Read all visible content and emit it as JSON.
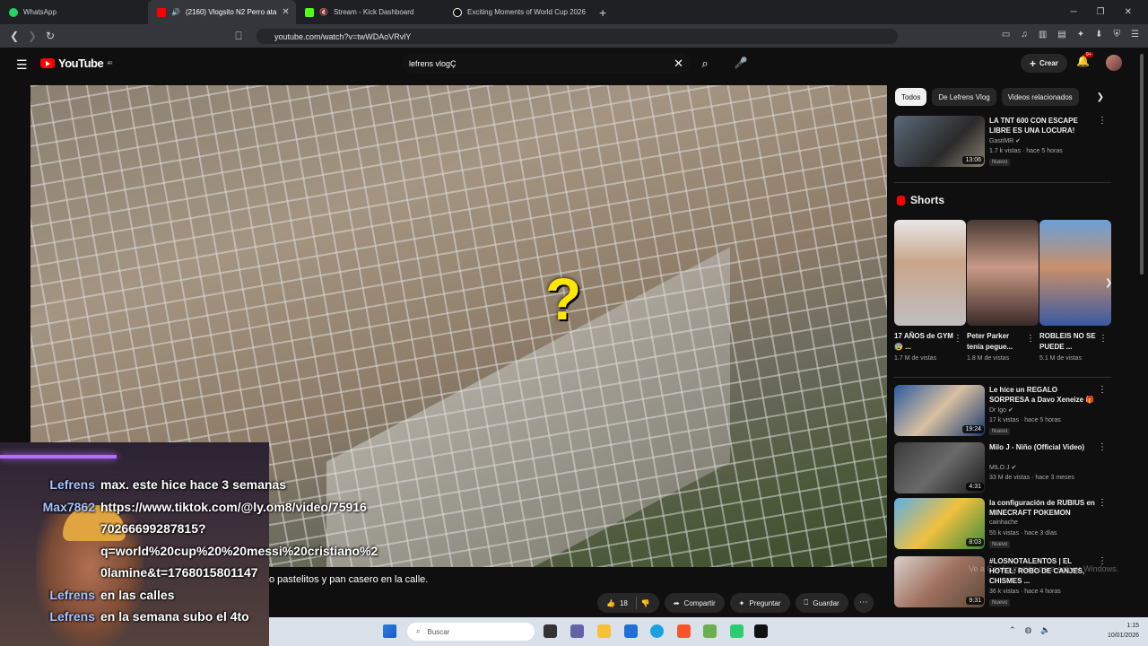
{
  "browser": {
    "tabs": [
      {
        "label": "WhatsApp",
        "color": "#25d366"
      },
      {
        "label": "(2160) Vlogsito N2 Perro ata",
        "color": "#ff0000"
      },
      {
        "label": "Stream - Kick Dashboard",
        "color": "#53fc18"
      },
      {
        "label": "Exciting Moments of World Cup 2026",
        "color": "#ffffff"
      }
    ],
    "url": "youtube.com/watch?v=twWDAoVRvlY"
  },
  "youtube": {
    "logo_text": "YouTube",
    "region": "AR",
    "search_value": "lefrens vlogÇ",
    "create_label": "Crear",
    "notifications": "9+"
  },
  "player": {
    "overlay_symbol": "?",
    "caption": "o pastelitos y pan casero en la calle.",
    "actions": {
      "likes": "18",
      "share": "Compartir",
      "ask": "Preguntar",
      "save": "Guardar"
    }
  },
  "sidebar": {
    "chips": [
      "Todos",
      "De Lefrens Vlog",
      "Videos relacionados"
    ],
    "top_video": {
      "title": "LA TNT 600 CON ESCAPE LIBRE ES UNA LOCURA!",
      "channel": "GastiMR ✔",
      "meta": "1.7 k vistas · hace 5 horas",
      "badge": "Nuevo",
      "duration": "13:06"
    },
    "shorts_label": "Shorts",
    "shorts": [
      {
        "title": "17 AÑOS de GYM 😰 ...",
        "views": "1.7 M de vistas"
      },
      {
        "title": "Peter Parker tenía pegue...",
        "views": "1.8 M de vistas"
      },
      {
        "title": "ROBLEIS NO SE PUEDE ...",
        "views": "5.1 M de vistas"
      }
    ],
    "videos": [
      {
        "title": "Le hice un REGALO SORPRESA a Davo Xeneize 🎁",
        "channel": "Dr Igo ✔",
        "meta": "17 k vistas · hace 5 horas",
        "badge": "Nuevo",
        "duration": "19:24"
      },
      {
        "title": "Milo J - Niño (Official Video)",
        "channel": "MILO J ✔",
        "meta": "33 M de vistas · hace 3 meses",
        "badge": "",
        "duration": "4:31"
      },
      {
        "title": "la configuración de RUBIUS en MINECRAFT POKEMON",
        "channel": "cainhache",
        "meta": "55 k vistas · hace 3 días",
        "badge": "Nuevo",
        "duration": "8:03"
      },
      {
        "title": "#LOSNOTALENTOS | EL HOTEL: ROBO DE CANJES, CHISMES ...",
        "channel": "",
        "meta": "36 k vistas · hace 4 horas",
        "badge": "Nuevo",
        "duration": "9:31"
      }
    ],
    "watermark": "Ve a Configuración para activar Windows."
  },
  "stream_chat": [
    {
      "user": "Lefrens",
      "msg": "max. este hice hace 3 semanas"
    },
    {
      "user": "Max7862",
      "msg": "https://www.tiktok.com/@ly.om8/video/75916"
    },
    {
      "user": "",
      "msg": "70266699287815?"
    },
    {
      "user": "",
      "msg": "q=world%20cup%20%20messi%20cristiano%2"
    },
    {
      "user": "",
      "msg": "0lamine&t=1768015801147"
    },
    {
      "user": "Lefrens",
      "msg": "en las calles"
    },
    {
      "user": "Lefrens",
      "msg": "en la semana subo el 4to"
    }
  ],
  "taskbar": {
    "search_placeholder": "Buscar",
    "time": "1:15",
    "date": "10/01/2026"
  }
}
